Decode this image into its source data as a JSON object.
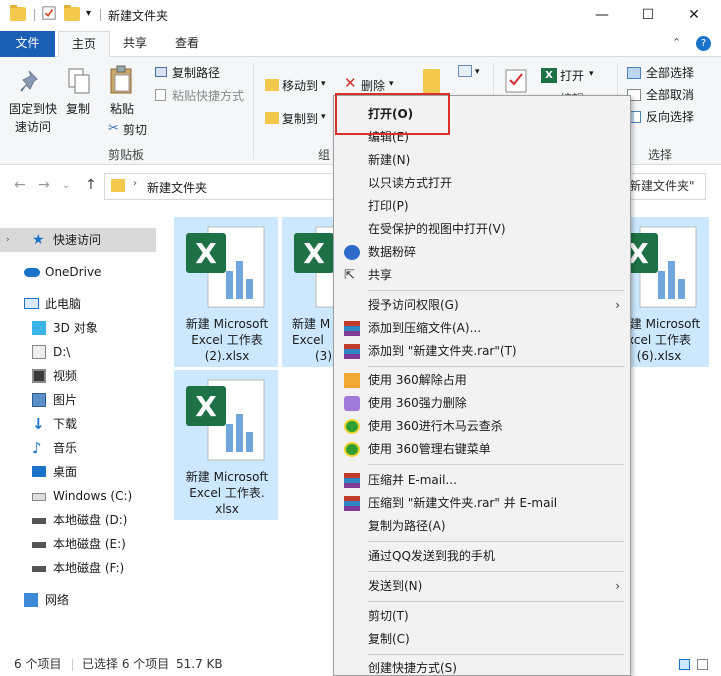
{
  "window": {
    "title": "新建文件夹",
    "minimize": "—",
    "maximize": "☐",
    "close": "✕"
  },
  "tabs": {
    "file": "文件",
    "home": "主页",
    "share": "共享",
    "view": "查看"
  },
  "ribbon": {
    "pin_label": "固定到快\n速访问",
    "copy_label": "复制",
    "paste_label": "粘贴",
    "copy_path": "复制路径",
    "paste_shortcut": "粘贴快捷方式",
    "cut": "剪切",
    "clipboard_group": "剪贴板",
    "move_to": "移动到",
    "copy_to": "复制到",
    "delete": "删除",
    "organize_group": "组",
    "open": "打开",
    "edit_partial": "编辑",
    "select_all": "全部选择",
    "select_none": "全部取消",
    "invert_selection": "反向选择",
    "select_group": "选择"
  },
  "address": {
    "path": "新建文件夹",
    "search_placeholder": "新建文件夹\""
  },
  "nav": {
    "items": [
      {
        "label": "快速访问",
        "icon": "star-icon"
      },
      {
        "label": "OneDrive",
        "icon": "cloud-icon"
      },
      {
        "label": "此电脑",
        "icon": "computer-icon"
      },
      {
        "label": "3D 对象",
        "icon": "cube-icon"
      },
      {
        "label": "D:\\",
        "icon": "drive-icon"
      },
      {
        "label": "视频",
        "icon": "video-icon"
      },
      {
        "label": "图片",
        "icon": "picture-icon"
      },
      {
        "label": "下载",
        "icon": "download-icon"
      },
      {
        "label": "音乐",
        "icon": "music-icon"
      },
      {
        "label": "桌面",
        "icon": "desktop-icon"
      },
      {
        "label": "Windows (C:)",
        "icon": "windows-drive-icon"
      },
      {
        "label": "本地磁盘 (D:)",
        "icon": "disk-icon"
      },
      {
        "label": "本地磁盘 (E:)",
        "icon": "disk-icon"
      },
      {
        "label": "本地磁盘 (F:)",
        "icon": "disk-icon"
      },
      {
        "label": "网络",
        "icon": "network-icon"
      }
    ]
  },
  "files": [
    {
      "line1": "新建 Microsoft",
      "line2": "Excel 工作表",
      "line3": "(2).xlsx"
    },
    {
      "line1": "新建 M",
      "line2": "Excel",
      "line3": "(3)"
    },
    {
      "line1": "新建 Microsoft",
      "line2": "xcel 工作表",
      "line3": "(6).xlsx"
    },
    {
      "line1": "新建 Microsoft",
      "line2": "Excel 工作表.",
      "line3": "xlsx"
    }
  ],
  "context_menu": {
    "items": [
      {
        "label": "打开(O)",
        "bold": true
      },
      {
        "label": "编辑(E)"
      },
      {
        "label": "新建(N)"
      },
      {
        "label": "以只读方式打开"
      },
      {
        "label": "打印(P)"
      },
      {
        "label": "在受保护的视图中打开(V)"
      },
      {
        "label": "数据粉碎"
      },
      {
        "label": "共享"
      },
      {
        "label": "授予访问权限(G)"
      },
      {
        "label": "添加到压缩文件(A)..."
      },
      {
        "label": "添加到 \"新建文件夹.rar\"(T)"
      },
      {
        "label": "使用 360解除占用"
      },
      {
        "label": "使用 360强力删除"
      },
      {
        "label": "使用 360进行木马云查杀"
      },
      {
        "label": "使用 360管理右键菜单"
      },
      {
        "label": "压缩并 E-mail..."
      },
      {
        "label": "压缩到 \"新建文件夹.rar\" 并 E-mail"
      },
      {
        "label": "复制为路径(A)"
      },
      {
        "label": "通过QQ发送到我的手机"
      },
      {
        "label": "发送到(N)"
      },
      {
        "label": "剪切(T)"
      },
      {
        "label": "复制(C)"
      },
      {
        "label": "创建快捷方式(S)"
      }
    ]
  },
  "status": {
    "count": "6 个项目",
    "selected": "已选择 6 个项目",
    "size": "51.7 KB"
  },
  "colors": {
    "accent": "#1a5fb4",
    "selection": "#cce8ff",
    "highlight_red": "#d9302c",
    "excel_green": "#1e7145"
  }
}
